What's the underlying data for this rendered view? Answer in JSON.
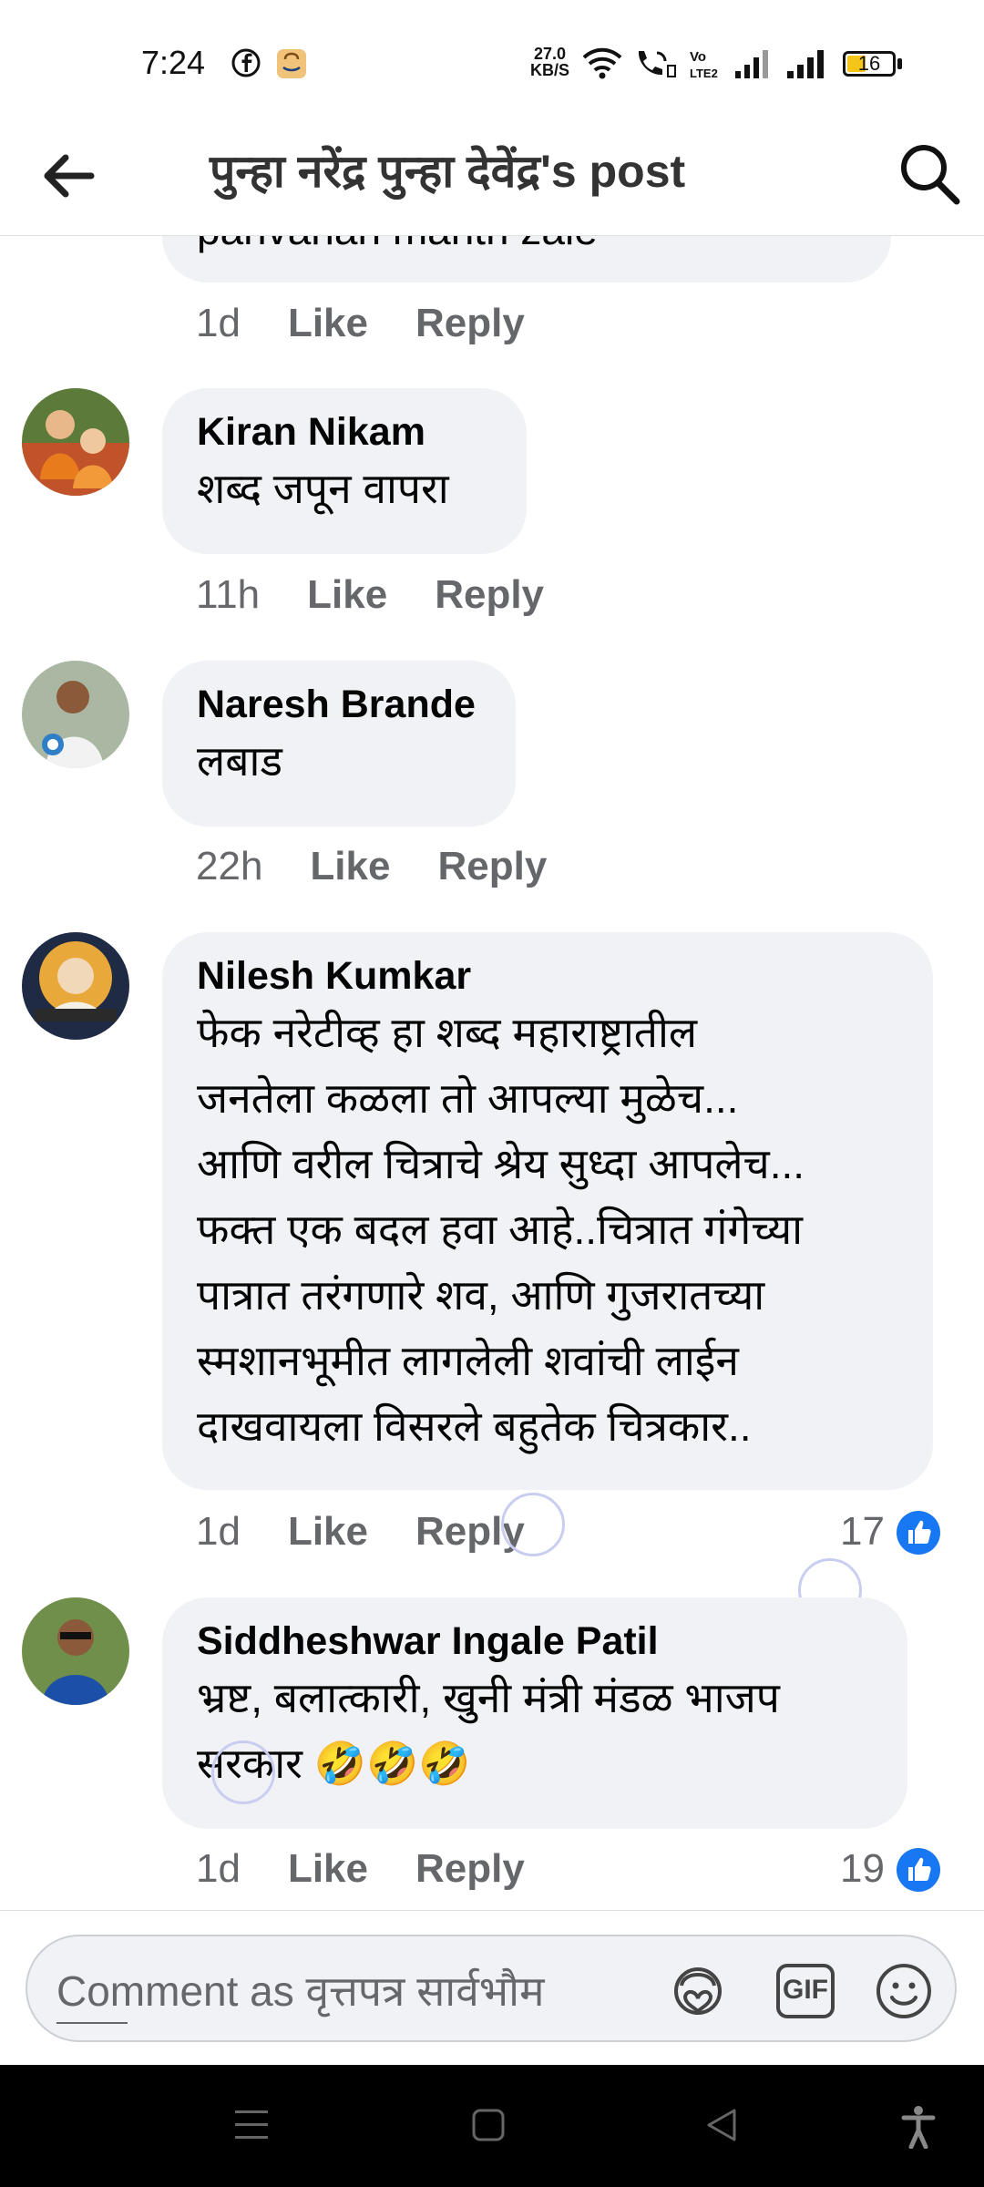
{
  "status_bar": {
    "time": "7:24",
    "network_speed_value": "27.0",
    "network_speed_unit": "KB/S",
    "volte_label": "Vo LTE2",
    "battery_level": "16",
    "icons": [
      "facebook-icon",
      "amazon-icon",
      "wifi-icon",
      "wifi-calling-icon",
      "volte-icon",
      "signal-icon",
      "signal-icon",
      "battery-icon"
    ]
  },
  "header": {
    "title": "पुन्हा नरेंद्र पुन्हा देवेंद्र's post",
    "back_icon": "arrow-left-icon",
    "search_icon": "search-icon"
  },
  "comments": [
    {
      "partial_text": "parivahan mantri zale",
      "time": "1d",
      "like_label": "Like",
      "reply_label": "Reply"
    },
    {
      "author": "Kiran Nikam",
      "text": "शब्द जपून वापरा",
      "time": "11h",
      "like_label": "Like",
      "reply_label": "Reply"
    },
    {
      "author": "Naresh Brande",
      "text": "लबाड",
      "time": "22h",
      "like_label": "Like",
      "reply_label": "Reply"
    },
    {
      "author": "Nilesh Kumkar",
      "text": "फेक नरेटीव्ह हा शब्द महाराष्ट्रातील\nजनतेला कळला तो आपल्या मुळेच...\nआणि वरील चित्राचे श्रेय सुध्दा आपलेच...\nफक्त एक बदल हवा आहे..चित्रात गंगेच्या\nपात्रात तरंगणारे शव, आणि गुजरातच्या\nस्मशानभूमीत लागलेली शवांची लाईन\nदाखवायला विसरले  बहुतेक चित्रकार..",
      "time": "1d",
      "like_label": "Like",
      "reply_label": "Reply",
      "reaction_count": "17"
    },
    {
      "author": "Siddheshwar Ingale Patil",
      "text": "भ्रष्ट, बलात्कारी, खुनी मंत्री मंडळ भाजप\nसरकार 🤣🤣🤣",
      "time": "1d",
      "like_label": "Like",
      "reply_label": "Reply",
      "reaction_count": "19"
    }
  ],
  "composer": {
    "placeholder": "Comment as वृत्तपत्र सार्वभौम",
    "icons": [
      "avatar-sticker-icon",
      "gif-icon",
      "emoji-icon"
    ],
    "gif_label": "GIF"
  },
  "navbar": {
    "icons": [
      "menu-icon",
      "home-square-icon",
      "back-triangle-icon",
      "accessibility-icon"
    ]
  },
  "colors": {
    "bubble_bg": "#f0f2f5",
    "meta_text": "#65676b",
    "like_blue": "#1877f2",
    "navbar_bg": "#000000"
  }
}
